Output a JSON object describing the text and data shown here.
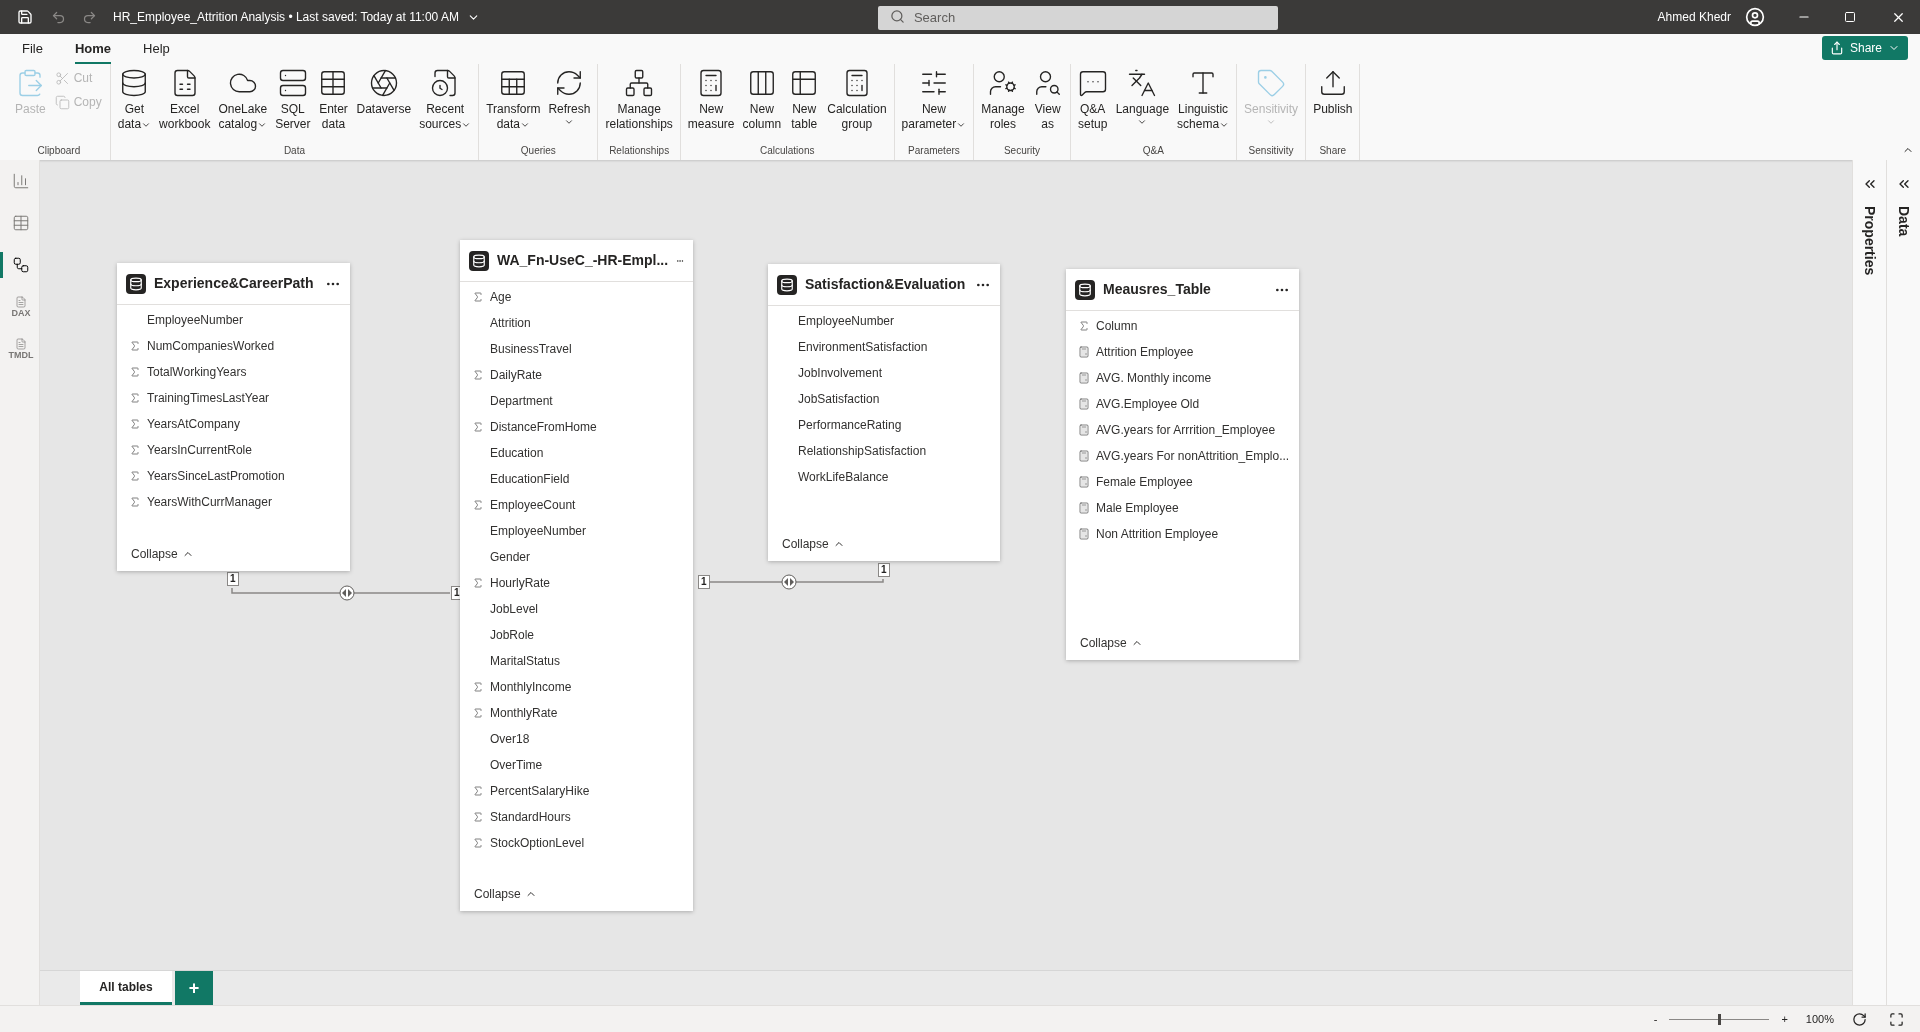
{
  "title_bar": {
    "title": "HR_Employee_Attrition Analysis • Last saved: Today at 11:00 AM",
    "search": {
      "placeholder": "Search"
    },
    "user": "Ahmed Khedr"
  },
  "menu_tabs": [
    {
      "label": "File",
      "selected": false
    },
    {
      "label": "Home",
      "selected": true
    },
    {
      "label": "Help",
      "selected": false
    }
  ],
  "share_button": "Share",
  "ribbon_groups": [
    {
      "label": "Clipboard",
      "buttons": [
        {
          "lines": [
            "Paste"
          ],
          "disabled": true,
          "dropdown": false,
          "kind": "large"
        },
        {
          "lines": [
            "Cut"
          ],
          "disabled": true,
          "dropdown": false,
          "kind": "small"
        },
        {
          "lines": [
            "Copy"
          ],
          "disabled": true,
          "dropdown": false,
          "kind": "small"
        }
      ]
    },
    {
      "label": "Data",
      "buttons": [
        {
          "lines": [
            "Get",
            "data"
          ],
          "disabled": false,
          "dropdown": true,
          "kind": "large"
        },
        {
          "lines": [
            "Excel",
            "workbook"
          ],
          "disabled": false,
          "dropdown": false,
          "kind": "large"
        },
        {
          "lines": [
            "OneLake",
            "catalog"
          ],
          "disabled": false,
          "dropdown": true,
          "kind": "large"
        },
        {
          "lines": [
            "SQL",
            "Server"
          ],
          "disabled": false,
          "dropdown": false,
          "kind": "large"
        },
        {
          "lines": [
            "Enter",
            "data"
          ],
          "disabled": false,
          "dropdown": false,
          "kind": "large"
        },
        {
          "lines": [
            "Dataverse"
          ],
          "disabled": false,
          "dropdown": false,
          "kind": "large"
        },
        {
          "lines": [
            "Recent",
            "sources"
          ],
          "disabled": false,
          "dropdown": true,
          "kind": "large"
        }
      ]
    },
    {
      "label": "Queries",
      "buttons": [
        {
          "lines": [
            "Transform",
            "data"
          ],
          "disabled": false,
          "dropdown": true,
          "kind": "large"
        },
        {
          "lines": [
            "Refresh"
          ],
          "disabled": false,
          "dropdown": true,
          "kind": "split"
        }
      ]
    },
    {
      "label": "Relationships",
      "buttons": [
        {
          "lines": [
            "Manage",
            "relationships"
          ],
          "disabled": false,
          "dropdown": false,
          "kind": "large"
        }
      ]
    },
    {
      "label": "Calculations",
      "buttons": [
        {
          "lines": [
            "New",
            "measure"
          ],
          "disabled": false,
          "dropdown": false,
          "kind": "large"
        },
        {
          "lines": [
            "New",
            "column"
          ],
          "disabled": false,
          "dropdown": false,
          "kind": "large"
        },
        {
          "lines": [
            "New",
            "table"
          ],
          "disabled": false,
          "dropdown": false,
          "kind": "large"
        },
        {
          "lines": [
            "Calculation",
            "group"
          ],
          "disabled": false,
          "dropdown": false,
          "kind": "large"
        }
      ]
    },
    {
      "label": "Parameters",
      "buttons": [
        {
          "lines": [
            "New",
            "parameter"
          ],
          "disabled": false,
          "dropdown": true,
          "kind": "large"
        }
      ]
    },
    {
      "label": "Security",
      "buttons": [
        {
          "lines": [
            "Manage",
            "roles"
          ],
          "disabled": false,
          "dropdown": false,
          "kind": "large"
        },
        {
          "lines": [
            "View",
            "as"
          ],
          "disabled": false,
          "dropdown": false,
          "kind": "large"
        }
      ]
    },
    {
      "label": "Q&A",
      "buttons": [
        {
          "lines": [
            "Q&A",
            "setup"
          ],
          "disabled": false,
          "dropdown": false,
          "kind": "large"
        },
        {
          "lines": [
            "Language"
          ],
          "disabled": false,
          "dropdown": true,
          "kind": "split"
        },
        {
          "lines": [
            "Linguistic",
            "schema"
          ],
          "disabled": false,
          "dropdown": true,
          "kind": "large"
        }
      ]
    },
    {
      "label": "Sensitivity",
      "buttons": [
        {
          "lines": [
            "Sensitivity"
          ],
          "disabled": true,
          "dropdown": true,
          "kind": "split"
        }
      ]
    },
    {
      "label": "Share",
      "buttons": [
        {
          "lines": [
            "Publish"
          ],
          "disabled": false,
          "dropdown": false,
          "kind": "large"
        }
      ]
    }
  ],
  "view_nav": [
    {
      "selected": false
    },
    {
      "selected": false
    },
    {
      "selected": true
    },
    {
      "selected": false,
      "label": "DAX"
    },
    {
      "selected": false,
      "label": "TMDL"
    }
  ],
  "tables": [
    {
      "title": "Experience&CareerPath",
      "fields": [
        {
          "name": "EmployeeNumber",
          "kind": "plain"
        },
        {
          "name": "NumCompaniesWorked",
          "kind": "sum"
        },
        {
          "name": "TotalWorkingYears",
          "kind": "sum"
        },
        {
          "name": "TrainingTimesLastYear",
          "kind": "sum"
        },
        {
          "name": "YearsAtCompany",
          "kind": "sum"
        },
        {
          "name": "YearsInCurrentRole",
          "kind": "sum"
        },
        {
          "name": "YearsSinceLastPromotion",
          "kind": "sum"
        },
        {
          "name": "YearsWithCurrManager",
          "kind": "sum"
        }
      ],
      "collapse": "Collapse"
    },
    {
      "title": "WA_Fn-UseC_-HR-Empl...",
      "fields": [
        {
          "name": "Age",
          "kind": "sum"
        },
        {
          "name": "Attrition",
          "kind": "plain"
        },
        {
          "name": "BusinessTravel",
          "kind": "plain"
        },
        {
          "name": "DailyRate",
          "kind": "sum"
        },
        {
          "name": "Department",
          "kind": "plain"
        },
        {
          "name": "DistanceFromHome",
          "kind": "sum"
        },
        {
          "name": "Education",
          "kind": "plain"
        },
        {
          "name": "EducationField",
          "kind": "plain"
        },
        {
          "name": "EmployeeCount",
          "kind": "sum"
        },
        {
          "name": "EmployeeNumber",
          "kind": "plain"
        },
        {
          "name": "Gender",
          "kind": "plain"
        },
        {
          "name": "HourlyRate",
          "kind": "sum"
        },
        {
          "name": "JobLevel",
          "kind": "plain"
        },
        {
          "name": "JobRole",
          "kind": "plain"
        },
        {
          "name": "MaritalStatus",
          "kind": "plain"
        },
        {
          "name": "MonthlyIncome",
          "kind": "sum"
        },
        {
          "name": "MonthlyRate",
          "kind": "sum"
        },
        {
          "name": "Over18",
          "kind": "plain"
        },
        {
          "name": "OverTime",
          "kind": "plain"
        },
        {
          "name": "PercentSalaryHike",
          "kind": "sum"
        },
        {
          "name": "StandardHours",
          "kind": "sum"
        },
        {
          "name": "StockOptionLevel",
          "kind": "sum"
        }
      ],
      "collapse": "Collapse"
    },
    {
      "title": "Satisfaction&Evaluation",
      "fields": [
        {
          "name": "EmployeeNumber",
          "kind": "plain"
        },
        {
          "name": "EnvironmentSatisfaction",
          "kind": "plain"
        },
        {
          "name": "JobInvolvement",
          "kind": "plain"
        },
        {
          "name": "JobSatisfaction",
          "kind": "plain"
        },
        {
          "name": "PerformanceRating",
          "kind": "plain"
        },
        {
          "name": "RelationshipSatisfaction",
          "kind": "plain"
        },
        {
          "name": "WorkLifeBalance",
          "kind": "plain"
        }
      ],
      "collapse": "Collapse"
    },
    {
      "title": "Meausres_Table",
      "fields": [
        {
          "name": "Column",
          "kind": "sum"
        },
        {
          "name": "Attrition Employee",
          "kind": "measure"
        },
        {
          "name": "AVG. Monthly income",
          "kind": "measure"
        },
        {
          "name": "AVG.Employee Old",
          "kind": "measure"
        },
        {
          "name": "AVG.years for Arrrition_Employee",
          "kind": "measure"
        },
        {
          "name": "AVG.years For nonAttrition_Emplo...",
          "kind": "measure"
        },
        {
          "name": "Female Employee",
          "kind": "measure"
        },
        {
          "name": "Male Employee",
          "kind": "measure"
        },
        {
          "name": "Non Attrition Employee",
          "kind": "measure"
        }
      ],
      "collapse": "Collapse"
    }
  ],
  "relationships": [
    {
      "from_label": "1",
      "to_label": "1",
      "bidirectional": true
    },
    {
      "from_label": "1",
      "to_label": "1",
      "bidirectional": true
    }
  ],
  "side_panes": [
    {
      "label": "Properties"
    },
    {
      "label": "Data"
    }
  ],
  "page_tabs": [
    {
      "label": "All tables",
      "selected": true
    }
  ],
  "add_tab": "+",
  "zoom": {
    "minus": "-",
    "plus": "+",
    "level": 0.5,
    "reading": "100%"
  }
}
